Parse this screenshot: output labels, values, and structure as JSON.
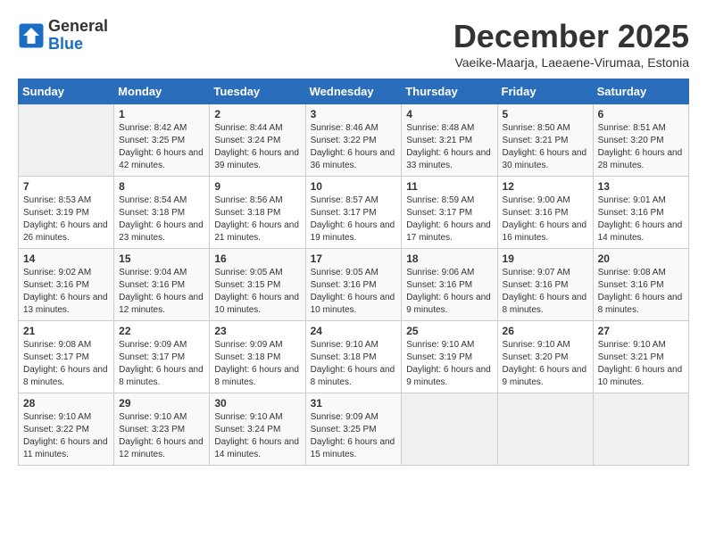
{
  "logo": {
    "line1": "General",
    "line2": "Blue"
  },
  "title": "December 2025",
  "subtitle": "Vaeike-Maarja, Laeaene-Virumaa, Estonia",
  "weekdays": [
    "Sunday",
    "Monday",
    "Tuesday",
    "Wednesday",
    "Thursday",
    "Friday",
    "Saturday"
  ],
  "weeks": [
    [
      {
        "day": "",
        "empty": true
      },
      {
        "day": "1",
        "sunrise": "8:42 AM",
        "sunset": "3:25 PM",
        "daylight": "6 hours and 42 minutes."
      },
      {
        "day": "2",
        "sunrise": "8:44 AM",
        "sunset": "3:24 PM",
        "daylight": "6 hours and 39 minutes."
      },
      {
        "day": "3",
        "sunrise": "8:46 AM",
        "sunset": "3:22 PM",
        "daylight": "6 hours and 36 minutes."
      },
      {
        "day": "4",
        "sunrise": "8:48 AM",
        "sunset": "3:21 PM",
        "daylight": "6 hours and 33 minutes."
      },
      {
        "day": "5",
        "sunrise": "8:50 AM",
        "sunset": "3:21 PM",
        "daylight": "6 hours and 30 minutes."
      },
      {
        "day": "6",
        "sunrise": "8:51 AM",
        "sunset": "3:20 PM",
        "daylight": "6 hours and 28 minutes."
      }
    ],
    [
      {
        "day": "7",
        "sunrise": "8:53 AM",
        "sunset": "3:19 PM",
        "daylight": "6 hours and 26 minutes."
      },
      {
        "day": "8",
        "sunrise": "8:54 AM",
        "sunset": "3:18 PM",
        "daylight": "6 hours and 23 minutes."
      },
      {
        "day": "9",
        "sunrise": "8:56 AM",
        "sunset": "3:18 PM",
        "daylight": "6 hours and 21 minutes."
      },
      {
        "day": "10",
        "sunrise": "8:57 AM",
        "sunset": "3:17 PM",
        "daylight": "6 hours and 19 minutes."
      },
      {
        "day": "11",
        "sunrise": "8:59 AM",
        "sunset": "3:17 PM",
        "daylight": "6 hours and 17 minutes."
      },
      {
        "day": "12",
        "sunrise": "9:00 AM",
        "sunset": "3:16 PM",
        "daylight": "6 hours and 16 minutes."
      },
      {
        "day": "13",
        "sunrise": "9:01 AM",
        "sunset": "3:16 PM",
        "daylight": "6 hours and 14 minutes."
      }
    ],
    [
      {
        "day": "14",
        "sunrise": "9:02 AM",
        "sunset": "3:16 PM",
        "daylight": "6 hours and 13 minutes."
      },
      {
        "day": "15",
        "sunrise": "9:04 AM",
        "sunset": "3:16 PM",
        "daylight": "6 hours and 12 minutes."
      },
      {
        "day": "16",
        "sunrise": "9:05 AM",
        "sunset": "3:15 PM",
        "daylight": "6 hours and 10 minutes."
      },
      {
        "day": "17",
        "sunrise": "9:05 AM",
        "sunset": "3:16 PM",
        "daylight": "6 hours and 10 minutes."
      },
      {
        "day": "18",
        "sunrise": "9:06 AM",
        "sunset": "3:16 PM",
        "daylight": "6 hours and 9 minutes."
      },
      {
        "day": "19",
        "sunrise": "9:07 AM",
        "sunset": "3:16 PM",
        "daylight": "6 hours and 8 minutes."
      },
      {
        "day": "20",
        "sunrise": "9:08 AM",
        "sunset": "3:16 PM",
        "daylight": "6 hours and 8 minutes."
      }
    ],
    [
      {
        "day": "21",
        "sunrise": "9:08 AM",
        "sunset": "3:17 PM",
        "daylight": "6 hours and 8 minutes."
      },
      {
        "day": "22",
        "sunrise": "9:09 AM",
        "sunset": "3:17 PM",
        "daylight": "6 hours and 8 minutes."
      },
      {
        "day": "23",
        "sunrise": "9:09 AM",
        "sunset": "3:18 PM",
        "daylight": "6 hours and 8 minutes."
      },
      {
        "day": "24",
        "sunrise": "9:10 AM",
        "sunset": "3:18 PM",
        "daylight": "6 hours and 8 minutes."
      },
      {
        "day": "25",
        "sunrise": "9:10 AM",
        "sunset": "3:19 PM",
        "daylight": "6 hours and 9 minutes."
      },
      {
        "day": "26",
        "sunrise": "9:10 AM",
        "sunset": "3:20 PM",
        "daylight": "6 hours and 9 minutes."
      },
      {
        "day": "27",
        "sunrise": "9:10 AM",
        "sunset": "3:21 PM",
        "daylight": "6 hours and 10 minutes."
      }
    ],
    [
      {
        "day": "28",
        "sunrise": "9:10 AM",
        "sunset": "3:22 PM",
        "daylight": "6 hours and 11 minutes."
      },
      {
        "day": "29",
        "sunrise": "9:10 AM",
        "sunset": "3:23 PM",
        "daylight": "6 hours and 12 minutes."
      },
      {
        "day": "30",
        "sunrise": "9:10 AM",
        "sunset": "3:24 PM",
        "daylight": "6 hours and 14 minutes."
      },
      {
        "day": "31",
        "sunrise": "9:09 AM",
        "sunset": "3:25 PM",
        "daylight": "6 hours and 15 minutes."
      },
      {
        "day": "",
        "empty": true
      },
      {
        "day": "",
        "empty": true
      },
      {
        "day": "",
        "empty": true
      }
    ]
  ]
}
